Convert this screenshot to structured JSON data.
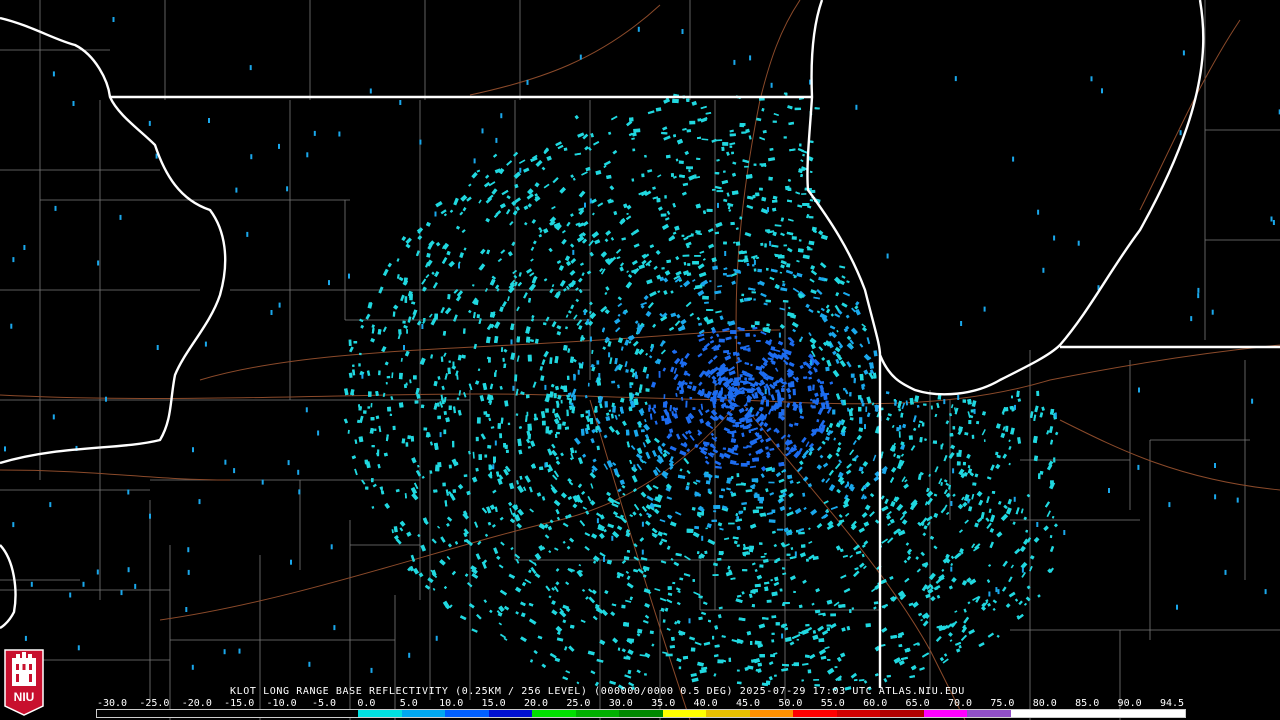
{
  "product": {
    "caption": "KLOT LONG RANGE BASE REFLECTIVITY (0.25KM / 256 LEVEL) (000000/0000 0.5 DEG) 2025-07-29 17:03 UTC  ATLAS.NIU.EDU"
  },
  "logo": {
    "text": "NIU",
    "bg_color": "#c8102e"
  },
  "scale": {
    "labels": [
      "-30.0",
      "-25.0",
      "-20.0",
      "-15.0",
      "-10.0",
      "-5.0",
      "0.0",
      "5.0",
      "10.0",
      "15.0",
      "20.0",
      "25.0",
      "30.0",
      "35.0",
      "40.0",
      "45.0",
      "50.0",
      "55.0",
      "60.0",
      "65.0",
      "70.0",
      "75.0",
      "80.0",
      "85.0",
      "90.0",
      "94.5"
    ],
    "colors": [
      "#000000",
      "#000000",
      "#000000",
      "#000000",
      "#000000",
      "#000000",
      "#00e0e0",
      "#00a8f0",
      "#0060ff",
      "#0010d0",
      "#00e000",
      "#00b000",
      "#008800",
      "#ffff00",
      "#e8c000",
      "#ff9000",
      "#ff0000",
      "#d00000",
      "#b00000",
      "#ff00ff",
      "#9050c8",
      "#ffffff",
      "#ffffff",
      "#ffffff",
      "#ffffff"
    ]
  },
  "radar": {
    "site_marker": "radar-site"
  },
  "map_colors": {
    "state_border": "#ffffff",
    "county_line": "#7a7a7a",
    "highway": "#8b4a2a",
    "echo_light": "#20d8e0",
    "echo_mid": "#1aa8ec",
    "echo_dense": "#1d6cf0"
  }
}
